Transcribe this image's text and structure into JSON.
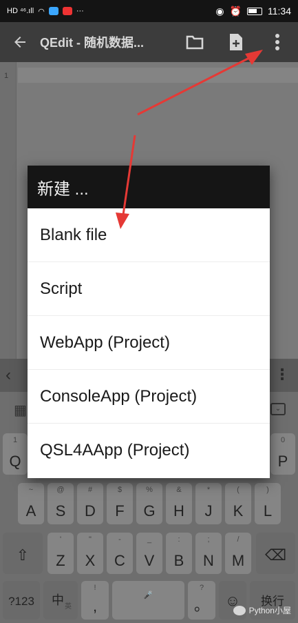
{
  "status_bar": {
    "left_indicators": "HD ⁴⁶.ıll",
    "more": "···",
    "time": "11:34"
  },
  "toolbar": {
    "back_icon": "arrow-left-icon",
    "title": "QEdit - 随机数据...",
    "folder_icon": "folder-icon",
    "new_file_icon": "new-file-icon",
    "overflow_icon": "more-vert-icon"
  },
  "editor": {
    "line_number": "1"
  },
  "dialog": {
    "title": "新建 ...",
    "items": [
      "Blank file",
      "Script",
      "WebApp (Project)",
      "ConsoleApp (Project)",
      "QSL4AApp (Project)"
    ]
  },
  "keyboard": {
    "row1": [
      {
        "main": "Q",
        "sub": "1"
      },
      {
        "main": "P",
        "sub": "0"
      }
    ],
    "row2": [
      {
        "main": "A",
        "sub": "~"
      },
      {
        "main": "S",
        "sub": "@"
      },
      {
        "main": "D",
        "sub": "#"
      },
      {
        "main": "F",
        "sub": "$"
      },
      {
        "main": "G",
        "sub": "%"
      },
      {
        "main": "H",
        "sub": "&"
      },
      {
        "main": "J",
        "sub": "*"
      },
      {
        "main": "K",
        "sub": "("
      },
      {
        "main": "L",
        "sub": ")"
      }
    ],
    "row3": [
      {
        "main": "Z",
        "sub": "'"
      },
      {
        "main": "X",
        "sub": "\""
      },
      {
        "main": "C",
        "sub": "-"
      },
      {
        "main": "V",
        "sub": "_"
      },
      {
        "main": "B",
        "sub": ":"
      },
      {
        "main": "N",
        "sub": ";"
      },
      {
        "main": "M",
        "sub": "/"
      }
    ],
    "shift": "⇧",
    "backspace": "⌫",
    "sym": "?123",
    "lang": "中",
    "lang_sub": "英",
    "comma_main": ",",
    "comma_sub": "!",
    "space_sub": "🎤",
    "period_main": "。",
    "period_sub": "?",
    "emoji": "☺",
    "enter": "换行"
  },
  "watermark": {
    "text": "Python小屋"
  },
  "colors": {
    "toolbar_bg": "#3c3c3c",
    "dialog_title_bg": "#151515",
    "arrow_red": "#e53935"
  }
}
